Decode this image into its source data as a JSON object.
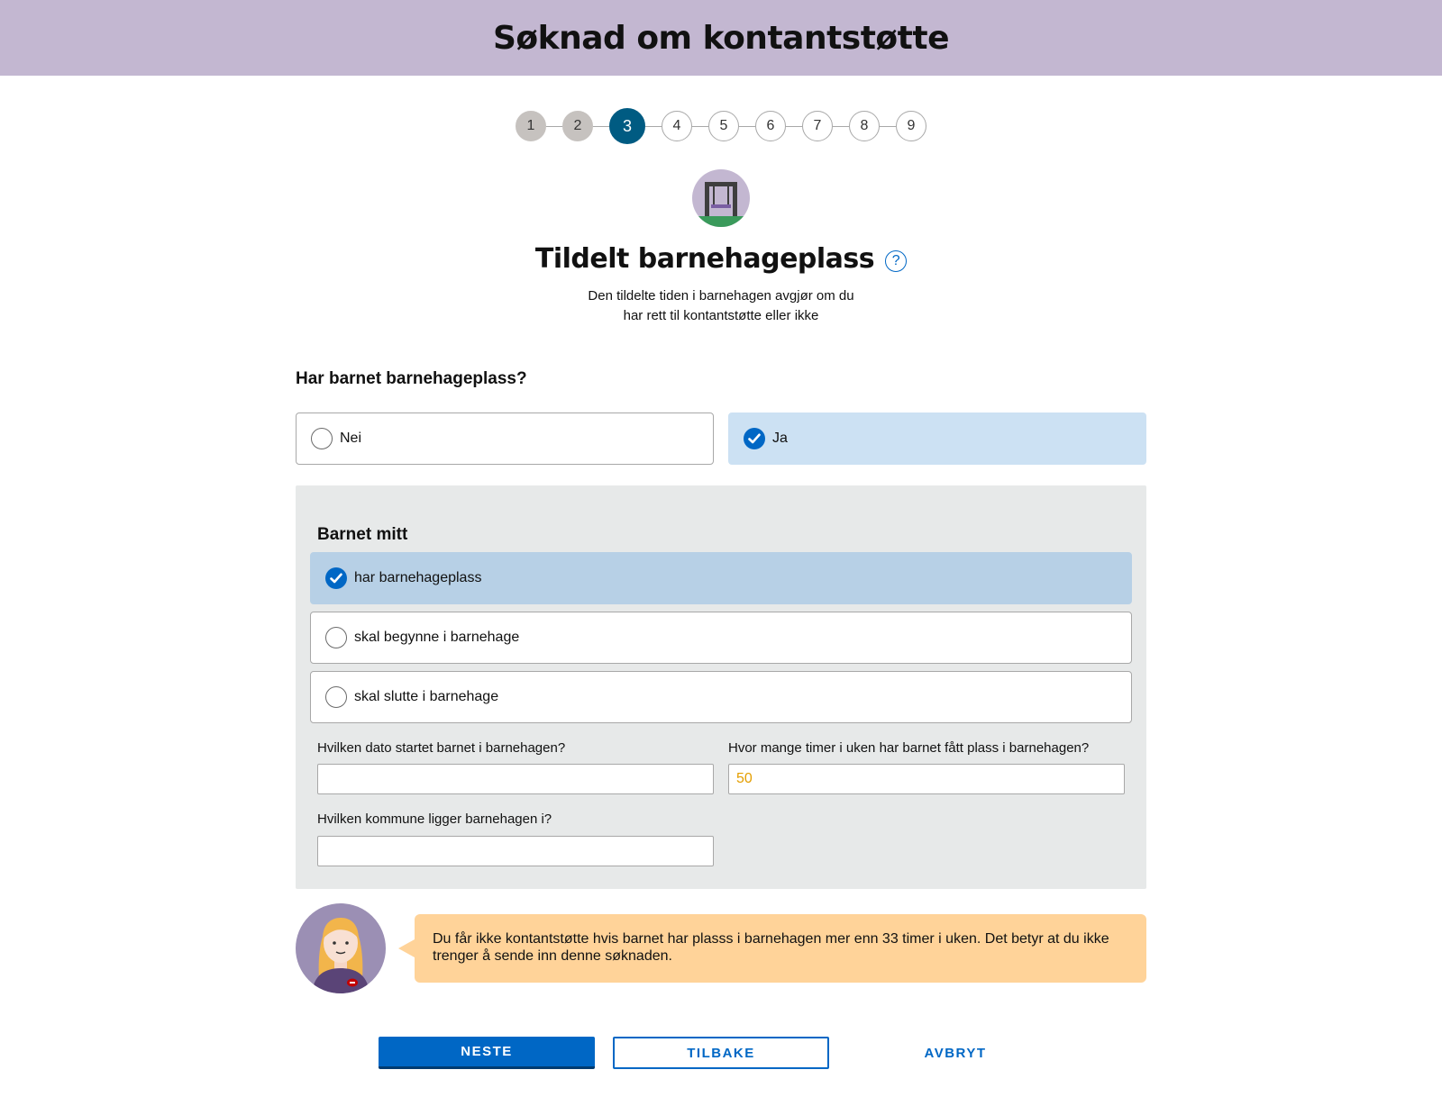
{
  "header": {
    "title": "Søknad om kontantstøtte"
  },
  "stepper": {
    "steps": [
      "1",
      "2",
      "3",
      "4",
      "5",
      "6",
      "7",
      "8",
      "9"
    ],
    "current": 3
  },
  "section": {
    "title": "Tildelt barnehageplass",
    "description_line1": "Den tildelte tiden i barnehagen avgjør om du",
    "description_line2": "har rett til kontantstøtte eller ikke",
    "help_icon": "question-mark-icon",
    "illustration_icon": "swing-icon"
  },
  "question": {
    "label": "Har barnet barnehageplass?",
    "options": [
      {
        "label": "Nei",
        "checked": false
      },
      {
        "label": "Ja",
        "checked": true
      }
    ]
  },
  "panel": {
    "title": "Barnet mitt",
    "options": [
      {
        "label": "har barnehageplass",
        "checked": true
      },
      {
        "label": "skal begynne i barnehage",
        "checked": false
      },
      {
        "label": "skal slutte i barnehage",
        "checked": false
      }
    ],
    "fields": {
      "start_date": {
        "label": "Hvilken dato startet barnet i barnehagen?",
        "value": ""
      },
      "hours": {
        "label": "Hvor mange timer i uken har barnet fått plass i barnehagen?",
        "value": "50"
      },
      "municipality": {
        "label": "Hvilken kommune ligger barnehagen i?",
        "value": ""
      }
    }
  },
  "veileder": {
    "avatar_icon": "guide-avatar-icon",
    "text": "Du får ikke kontantstøtte hvis barnet har plasss i barnehagen mer enn 33 timer i uken. Det betyr at du ikke trenger å sende inn denne søknaden."
  },
  "buttons": {
    "next": "NESTE",
    "back": "TILBAKE",
    "cancel": "AVBRYT"
  },
  "colors": {
    "header_bg": "#c3b7d1",
    "primary": "#0067c5",
    "active_step": "#005b82",
    "panel_bg": "#e7e9e9",
    "bubble_bg": "#ffd399"
  }
}
